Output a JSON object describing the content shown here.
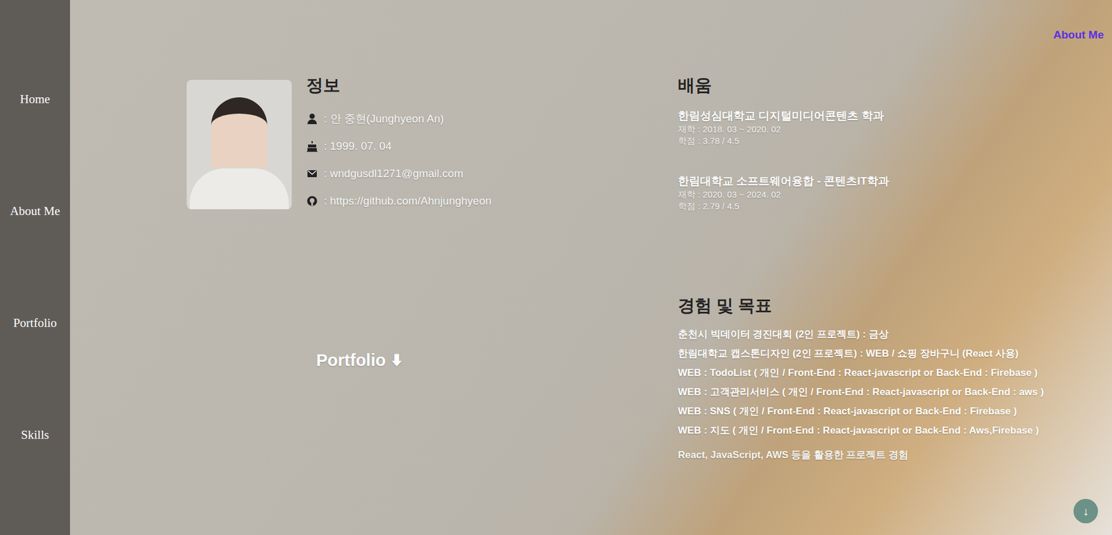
{
  "sidebar": {
    "items": [
      {
        "label": "Home"
      },
      {
        "label": "About Me"
      },
      {
        "label": "Portfolio"
      },
      {
        "label": "Skills"
      }
    ]
  },
  "header": {
    "title": "About Me"
  },
  "info": {
    "heading": "정보",
    "rows": [
      {
        "kind": "name",
        "text": ": 안 중현(Junghyeon An)"
      },
      {
        "kind": "birthday",
        "text": ": 1999. 07. 04"
      },
      {
        "kind": "email",
        "text": ": wndgusdl1271@gmail.com"
      },
      {
        "kind": "github",
        "text": ": https://github.com/Ahnjunghyeon"
      }
    ]
  },
  "portfolio_link": {
    "label": "Portfolio",
    "icon": "⬇"
  },
  "education": {
    "heading": "배움",
    "items": [
      {
        "school": "한림성심대학교 디지털미디어콘텐츠 학과",
        "period": "재학 : 2018. 03 ~ 2020. 02",
        "grade": "학점 : 3.78 / 4.5"
      },
      {
        "school": "한림대학교 소프트웨어융합 - 콘텐츠IT학과",
        "period": "재학 : 2020. 03 ~ 2024. 02",
        "grade": "학점 : 2.79 / 4.5"
      }
    ]
  },
  "experience": {
    "heading": "경험 및 목표",
    "items": [
      "춘천시 빅데이터 경진대회 (2인 프로젝트) : 금상",
      "한림대학교 캡스톤디자인 (2인 프로젝트) : WEB / 쇼핑 장바구니 (React 사용)",
      "WEB : TodoList ( 개인 / Front-End : React-javascript or Back-End : Firebase )",
      "WEB : 고객관리서비스 ( 개인 / Front-End : React-javascript or Back-End : aws )",
      "WEB : SNS ( 개인 / Front-End : React-javascript or Back-End : Firebase )",
      "WEB : 지도 ( 개인 / Front-End : React-javascript or Back-End : Aws,Firebase )"
    ],
    "summary": "React, JavaScript, AWS 등을 활용한 프로젝트 경험"
  },
  "scroll_button": {
    "label": "↓"
  }
}
